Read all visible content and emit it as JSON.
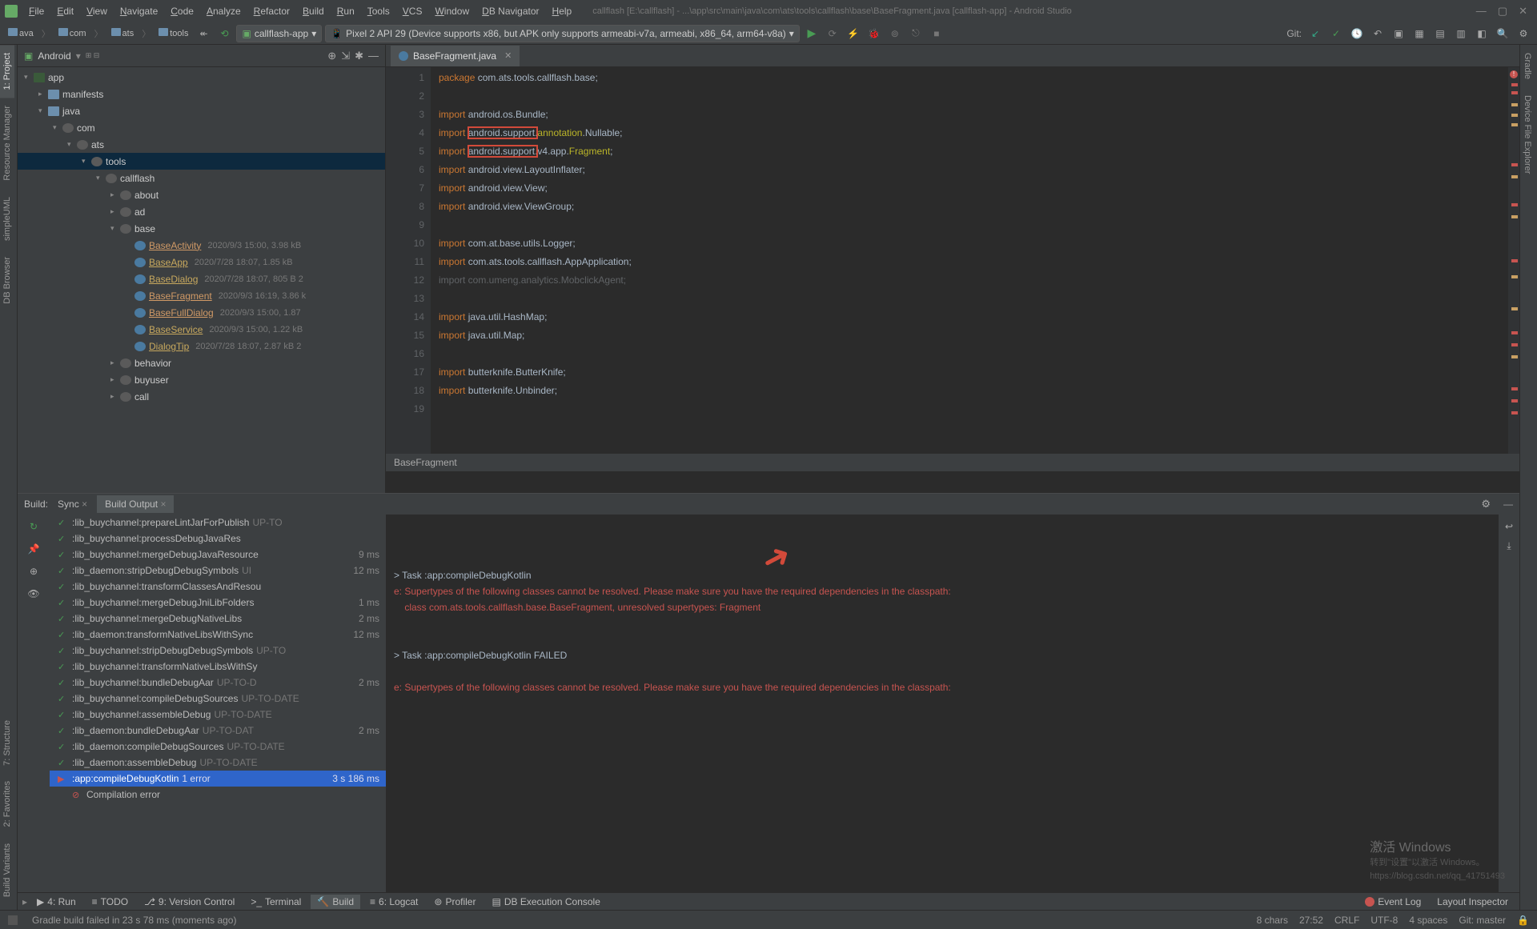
{
  "window": {
    "title": "callflash [E:\\callflash] - ...\\app\\src\\main\\java\\com\\ats\\tools\\callflash\\base\\BaseFragment.java [callflash-app] - Android Studio"
  },
  "menus": [
    "File",
    "Edit",
    "View",
    "Navigate",
    "Code",
    "Analyze",
    "Refactor",
    "Build",
    "Run",
    "Tools",
    "VCS",
    "Window",
    "DB Navigator",
    "Help"
  ],
  "breadcrumbs": [
    "ava",
    "com",
    "ats",
    "tools"
  ],
  "toolbar": {
    "run_config": "callflash-app",
    "device": "Pixel 2 API 29 (Device supports x86, but APK only supports armeabi-v7a, armeabi, x86_64, arm64-v8a)",
    "git_label": "Git:"
  },
  "left_tabs": [
    "1: Project",
    "Resource Manager",
    "simpleUML",
    "DB Browser"
  ],
  "left_tabs_low": [
    "7: Structure",
    "2: Favorites",
    "Build Variants"
  ],
  "right_tabs": [
    "Gradle",
    "Device File Explorer"
  ],
  "project": {
    "title": "Android",
    "tree": [
      {
        "d": 0,
        "t": "mod",
        "arrow": "▾",
        "name": "app"
      },
      {
        "d": 1,
        "t": "folder",
        "arrow": "▸",
        "name": "manifests"
      },
      {
        "d": 1,
        "t": "folder",
        "arrow": "▾",
        "name": "java"
      },
      {
        "d": 2,
        "t": "pkg",
        "arrow": "▾",
        "name": "com"
      },
      {
        "d": 3,
        "t": "pkg",
        "arrow": "▾",
        "name": "ats"
      },
      {
        "d": 4,
        "t": "pkg",
        "arrow": "▾",
        "name": "tools",
        "sel": true
      },
      {
        "d": 5,
        "t": "pkg",
        "arrow": "▾",
        "name": "callflash"
      },
      {
        "d": 6,
        "t": "pkg",
        "arrow": "▸",
        "name": "about"
      },
      {
        "d": 6,
        "t": "pkg",
        "arrow": "▸",
        "name": "ad"
      },
      {
        "d": 6,
        "t": "pkg",
        "arrow": "▾",
        "name": "base"
      },
      {
        "d": 7,
        "t": "cls",
        "name": "BaseActivity",
        "link": true,
        "hi": true,
        "meta": "2020/9/3 15:00, 3.98 kB"
      },
      {
        "d": 7,
        "t": "cls",
        "name": "BaseApp",
        "link": true,
        "meta": "2020/7/28 18:07, 1.85 kB"
      },
      {
        "d": 7,
        "t": "cls",
        "name": "BaseDialog",
        "link": true,
        "meta": "2020/7/28 18:07, 805 B 2"
      },
      {
        "d": 7,
        "t": "cls",
        "name": "BaseFragment",
        "link": true,
        "hi": true,
        "meta": "2020/9/3 16:19, 3.86 k"
      },
      {
        "d": 7,
        "t": "cls",
        "name": "BaseFullDialog",
        "link": true,
        "hi": true,
        "meta": "2020/9/3 15:00, 1.87"
      },
      {
        "d": 7,
        "t": "cls",
        "name": "BaseService",
        "link": true,
        "meta": "2020/9/3 15:00, 1.22 kB"
      },
      {
        "d": 7,
        "t": "cls",
        "name": "DialogTip",
        "link": true,
        "meta": "2020/7/28 18:07, 2.87 kB 2"
      },
      {
        "d": 6,
        "t": "pkg",
        "arrow": "▸",
        "name": "behavior"
      },
      {
        "d": 6,
        "t": "pkg",
        "arrow": "▸",
        "name": "buyuser"
      },
      {
        "d": 6,
        "t": "pkg",
        "arrow": "▸",
        "name": "call"
      }
    ]
  },
  "editor": {
    "tab": "BaseFragment.java",
    "footer_crumb": "BaseFragment",
    "gutter": [
      "1",
      "2",
      "3",
      "4",
      "5",
      "6",
      "7",
      "8",
      "9",
      "10",
      "11",
      "12",
      "13",
      "14",
      "15",
      "16",
      "17",
      "18",
      "19"
    ],
    "code_lines": [
      {
        "tokens": [
          {
            "t": "package ",
            "c": "kw"
          },
          {
            "t": "com.ats.tools.callflash.base;",
            "c": "pkg"
          }
        ]
      },
      {
        "tokens": []
      },
      {
        "tokens": [
          {
            "t": "import ",
            "c": "kw"
          },
          {
            "t": "android.os.Bundle;",
            "c": "pkg"
          }
        ]
      },
      {
        "tokens": [
          {
            "t": "import ",
            "c": "kw"
          },
          {
            "t": "android.support.",
            "c": "pkg",
            "box": true
          },
          {
            "t": "annotation",
            "c": "ann"
          },
          {
            "t": ".Nullable;",
            "c": "pkg"
          }
        ]
      },
      {
        "tokens": [
          {
            "t": "import ",
            "c": "kw"
          },
          {
            "t": "android.support.",
            "c": "pkg",
            "box": true
          },
          {
            "t": "v4.app.",
            "c": "pkg"
          },
          {
            "t": "Fragment",
            "c": "ann"
          },
          {
            "t": ";",
            "c": "pkg"
          }
        ]
      },
      {
        "tokens": [
          {
            "t": "import ",
            "c": "kw"
          },
          {
            "t": "android.view.LayoutInflater;",
            "c": "pkg"
          }
        ]
      },
      {
        "tokens": [
          {
            "t": "import ",
            "c": "kw"
          },
          {
            "t": "android.view.View;",
            "c": "pkg"
          }
        ]
      },
      {
        "tokens": [
          {
            "t": "import ",
            "c": "kw"
          },
          {
            "t": "android.view.ViewGroup;",
            "c": "pkg"
          }
        ]
      },
      {
        "tokens": []
      },
      {
        "tokens": [
          {
            "t": "import ",
            "c": "kw"
          },
          {
            "t": "com.at.base.utils.Logger;",
            "c": "pkg"
          }
        ]
      },
      {
        "tokens": [
          {
            "t": "import ",
            "c": "kw"
          },
          {
            "t": "com.ats.tools.callflash.AppApplication;",
            "c": "pkg"
          }
        ]
      },
      {
        "tokens": [
          {
            "t": "import com.umeng.analytics.MobclickAgent;",
            "c": "dim"
          }
        ]
      },
      {
        "tokens": []
      },
      {
        "tokens": [
          {
            "t": "import ",
            "c": "kw"
          },
          {
            "t": "java.util.HashMap;",
            "c": "pkg"
          }
        ]
      },
      {
        "tokens": [
          {
            "t": "import ",
            "c": "kw"
          },
          {
            "t": "java.util.Map;",
            "c": "pkg"
          }
        ]
      },
      {
        "tokens": []
      },
      {
        "tokens": [
          {
            "t": "import ",
            "c": "kw"
          },
          {
            "t": "butterknife.ButterKnife;",
            "c": "pkg"
          }
        ]
      },
      {
        "tokens": [
          {
            "t": "import ",
            "c": "kw"
          },
          {
            "t": "butterknife.Unbinder;",
            "c": "pkg"
          }
        ]
      },
      {
        "tokens": []
      }
    ]
  },
  "build": {
    "label": "Build:",
    "tabs": [
      "Sync",
      "Build Output"
    ],
    "tree": [
      {
        "ico": "ok",
        "name": ":lib_buychannel:prepareLintJarForPublish",
        "tag": "UP-TO"
      },
      {
        "ico": "ok",
        "name": ":lib_buychannel:processDebugJavaRes"
      },
      {
        "ico": "ok",
        "name": ":lib_buychannel:mergeDebugJavaResource",
        "time": "9 ms"
      },
      {
        "ico": "ok",
        "name": ":lib_daemon:stripDebugDebugSymbols",
        "tag": "UI",
        "time": "12 ms"
      },
      {
        "ico": "ok",
        "name": ":lib_buychannel:transformClassesAndResou"
      },
      {
        "ico": "ok",
        "name": ":lib_buychannel:mergeDebugJniLibFolders",
        "time": "1 ms"
      },
      {
        "ico": "ok",
        "name": ":lib_buychannel:mergeDebugNativeLibs",
        "time": "2 ms"
      },
      {
        "ico": "ok",
        "name": ":lib_daemon:transformNativeLibsWithSync",
        "time": "12 ms"
      },
      {
        "ico": "ok",
        "name": ":lib_buychannel:stripDebugDebugSymbols",
        "tag": "UP-TO"
      },
      {
        "ico": "ok",
        "name": ":lib_buychannel:transformNativeLibsWithSy"
      },
      {
        "ico": "ok",
        "name": ":lib_buychannel:bundleDebugAar",
        "tag": "UP-TO-D",
        "time": "2 ms"
      },
      {
        "ico": "ok",
        "name": ":lib_buychannel:compileDebugSources",
        "tag": "UP-TO-DATE"
      },
      {
        "ico": "ok",
        "name": ":lib_buychannel:assembleDebug",
        "tag": "UP-TO-DATE"
      },
      {
        "ico": "ok",
        "name": ":lib_daemon:bundleDebugAar",
        "tag": "UP-TO-DAT",
        "time": "2 ms"
      },
      {
        "ico": "ok",
        "name": ":lib_daemon:compileDebugSources",
        "tag": "UP-TO-DATE"
      },
      {
        "ico": "ok",
        "name": ":lib_daemon:assembleDebug",
        "tag": "UP-TO-DATE"
      },
      {
        "ico": "err",
        "name": ":app:compileDebugKotlin",
        "tag": "1 error",
        "time": "3 s 186 ms",
        "sel": true,
        "play": true
      },
      {
        "ico": "err",
        "name": "Compilation error",
        "indent": 1
      }
    ],
    "console": [
      {
        "t": "> Task :app:compileDebugKotlin"
      },
      {
        "t": "e: Supertypes of the following classes cannot be resolved. Please make sure you have the required dependencies in the classpath:",
        "err": true
      },
      {
        "t": "    class com.ats.tools.callflash.base.BaseFragment, unresolved supertypes: Fragment",
        "err": true
      },
      {
        "t": ""
      },
      {
        "t": ""
      },
      {
        "t": "> Task :app:compileDebugKotlin FAILED"
      },
      {
        "t": ""
      },
      {
        "t": "e: Supertypes of the following classes cannot be resolved. Please make sure you have the required dependencies in the classpath:",
        "err": true
      }
    ]
  },
  "bottom_tools": [
    {
      "ico": "▶",
      "label": "4: Run"
    },
    {
      "ico": "≡",
      "label": "TODO"
    },
    {
      "ico": "⎇",
      "label": "9: Version Control"
    },
    {
      "ico": ">_",
      "label": "Terminal"
    },
    {
      "ico": "🔨",
      "label": "Build",
      "active": true
    },
    {
      "ico": "≡",
      "label": "6: Logcat"
    },
    {
      "ico": "⊚",
      "label": "Profiler"
    },
    {
      "ico": "▤",
      "label": "DB Execution Console"
    }
  ],
  "bottom_right": [
    {
      "ico": "err",
      "label": "Event Log"
    },
    {
      "ico": "",
      "label": "Layout Inspector"
    }
  ],
  "status": {
    "msg": "Gradle build failed in 23 s 78 ms (moments ago)",
    "right": [
      "8 chars",
      "27:52",
      "CRLF",
      "UTF-8",
      "4 spaces",
      "Git: master"
    ]
  },
  "watermark": {
    "t1": "激活 Windows",
    "t2": "转到\"设置\"以激活 Windows。",
    "t3": "https://blog.csdn.net/qq_41751493"
  }
}
